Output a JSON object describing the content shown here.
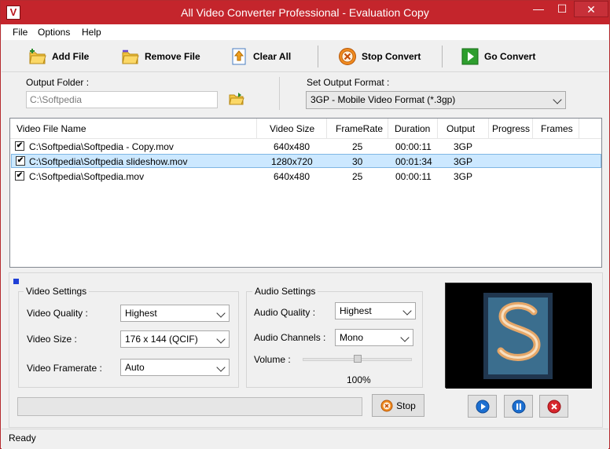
{
  "window": {
    "title": "All Video Converter Professional - Evaluation Copy",
    "app_icon_letter": "V",
    "controls": {
      "minimize": "—",
      "maximize": "☐",
      "close": "✕"
    }
  },
  "menu": [
    "File",
    "Options",
    "Help"
  ],
  "toolbar": {
    "add_file": "Add File",
    "remove_file": "Remove File",
    "clear_all": "Clear All",
    "stop_convert": "Stop Convert",
    "go_convert": "Go Convert"
  },
  "output": {
    "folder_label": "Output Folder :",
    "folder_value": "C:\\Softpedia",
    "format_label": "Set Output Format :",
    "format_value": "3GP - Mobile Video Format (*.3gp)"
  },
  "file_list": {
    "columns": [
      "Video File Name",
      "Video Size",
      "FrameRate",
      "Duration",
      "Output",
      "Progress",
      "Frames"
    ],
    "rows": [
      {
        "checked": true,
        "name": "C:\\Softpedia\\Softpedia - Copy.mov",
        "size": "640x480",
        "framerate": "25",
        "duration": "00:00:11",
        "output": "3GP",
        "progress": "",
        "frames": ""
      },
      {
        "checked": true,
        "name": "C:\\Softpedia\\Softpedia slideshow.mov",
        "size": "1280x720",
        "framerate": "30",
        "duration": "00:01:34",
        "output": "3GP",
        "progress": "",
        "frames": ""
      },
      {
        "checked": true,
        "name": "C:\\Softpedia\\Softpedia.mov",
        "size": "640x480",
        "framerate": "25",
        "duration": "00:00:11",
        "output": "3GP",
        "progress": "",
        "frames": ""
      }
    ],
    "check_mark": "✔"
  },
  "video_settings": {
    "title": "Video Settings",
    "quality_label": "Video Quality :",
    "quality_value": "Highest",
    "size_label": "Video Size :",
    "size_value": "176 x 144 (QCIF)",
    "framerate_label": "Video Framerate :",
    "framerate_value": "Auto"
  },
  "audio_settings": {
    "title": "Audio Settings",
    "quality_label": "Audio Quality :",
    "quality_value": "Highest",
    "channels_label": "Audio Channels :",
    "channels_value": "Mono",
    "volume_label": "Volume :",
    "volume_percent": "100%",
    "volume_level": 1.0
  },
  "conversion": {
    "progress_fraction": 0,
    "stop_button": "Stop"
  },
  "status": {
    "text": "Ready"
  },
  "colors": {
    "title_bar": "#c4252c",
    "selection": "#cce8ff",
    "go_green": "#2e9e2e",
    "stop_orange": "#f08a1e"
  }
}
